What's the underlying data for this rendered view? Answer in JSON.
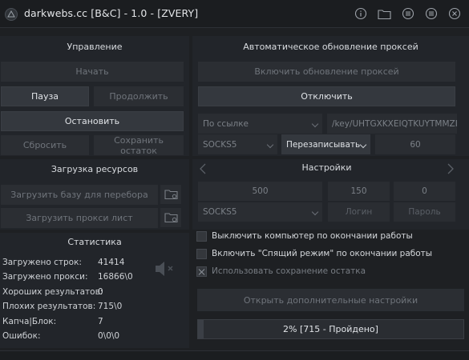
{
  "title": "darkwebs.cc [B&C] - 1.0 - [ZVERY]",
  "titlebar_icons": [
    "info-icon",
    "folder-icon",
    "list-icon",
    "menu-icon",
    "close-icon"
  ],
  "management": {
    "header": "Управление",
    "start": "Начать",
    "pause": "Пауза",
    "resume": "Продолжить",
    "stop": "Остановить",
    "reset": "Сбросить",
    "save_remainder": "Сохранить остаток"
  },
  "resources": {
    "header": "Загрузка ресурсов",
    "load_base": "Загрузить базу для перебора",
    "load_proxy": "Загрузить прокси лист"
  },
  "stats": {
    "header": "Статистика",
    "rows": [
      {
        "label": "Загружено строк:",
        "value": "41414"
      },
      {
        "label": "Загружено прокси:",
        "value": "16866\\0"
      },
      {
        "label": "Хороших результатов:",
        "value": "0"
      },
      {
        "label": "Плохих результатов:",
        "value": "715\\0"
      },
      {
        "label": "Капча|Блок:",
        "value": "7"
      },
      {
        "label": "Ошибок:",
        "value": "0\\0\\0"
      }
    ]
  },
  "proxy_update": {
    "header": "Автоматическое обновление проксей",
    "enable": "Включить обновление проксей",
    "disable": "Отключить",
    "source_select": "По ссылке",
    "url": "/key/UHTGXKXEIQTKUYTMMZIYC",
    "proto_select": "SOCKS5",
    "rewrite_select": "Перезаписывать",
    "interval": "60"
  },
  "settings": {
    "header": "Настройки",
    "threads": "500",
    "timeout": "150",
    "retries": "0",
    "proxy_type": "SOCKS5",
    "login_placeholder": "Логин",
    "password_placeholder": "Пароль"
  },
  "options": [
    {
      "label": "Выключить компьютер по окончании работы",
      "checked": false,
      "disabled": false
    },
    {
      "label": "Включить \"Спящий режим\" по окончании работы",
      "checked": false,
      "disabled": false
    },
    {
      "label": "Использовать сохранение остатка",
      "checked": true,
      "disabled": true
    }
  ],
  "advanced_button": "Открыть дополнительные настройки",
  "progress": {
    "percent": 2,
    "label": "2% [715 - Пройдено]"
  },
  "colors": {
    "bg": "#1e2023",
    "panel": "#22252a",
    "button": "#2b2e33",
    "active": "#34383e"
  }
}
